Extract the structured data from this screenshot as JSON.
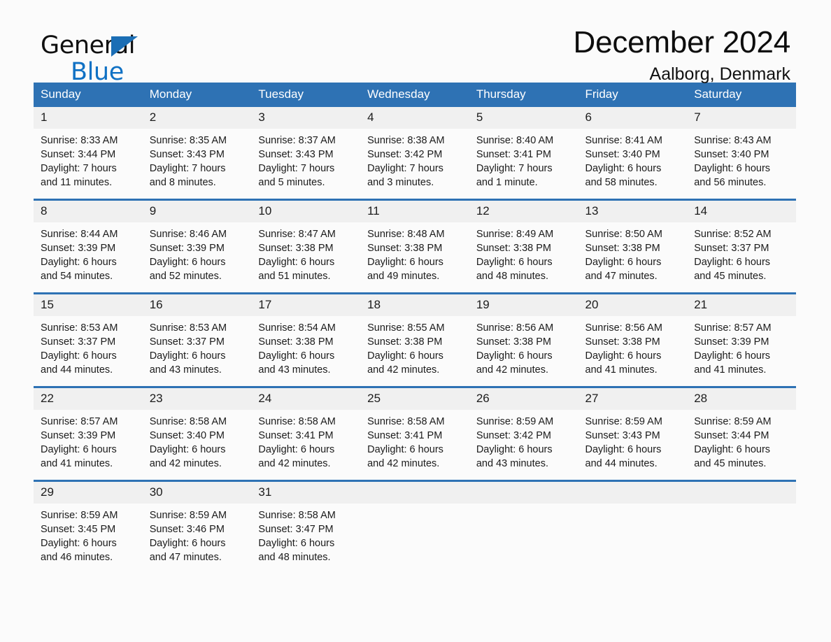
{
  "brand": {
    "name_part1": "General",
    "name_part2": "Blue",
    "triangle_color": "#1b6eb5",
    "text_color_part2": "#1071c4"
  },
  "header": {
    "month_title": "December 2024",
    "location": "Aalborg, Denmark"
  },
  "theme": {
    "header_blue": "#2e72b4",
    "daynum_band": "#f0f0f0",
    "page_background": "#fbfbfb"
  },
  "calendar": {
    "weekday_headers": [
      "Sunday",
      "Monday",
      "Tuesday",
      "Wednesday",
      "Thursday",
      "Friday",
      "Saturday"
    ],
    "labels": {
      "sunrise": "Sunrise:",
      "sunset": "Sunset:",
      "daylight": "Daylight:"
    },
    "weeks": [
      [
        {
          "day": "1",
          "sunrise": "Sunrise: 8:33 AM",
          "sunset": "Sunset: 3:44 PM",
          "daylight_line1": "Daylight: 7 hours",
          "daylight_line2": "and 11 minutes."
        },
        {
          "day": "2",
          "sunrise": "Sunrise: 8:35 AM",
          "sunset": "Sunset: 3:43 PM",
          "daylight_line1": "Daylight: 7 hours",
          "daylight_line2": "and 8 minutes."
        },
        {
          "day": "3",
          "sunrise": "Sunrise: 8:37 AM",
          "sunset": "Sunset: 3:43 PM",
          "daylight_line1": "Daylight: 7 hours",
          "daylight_line2": "and 5 minutes."
        },
        {
          "day": "4",
          "sunrise": "Sunrise: 8:38 AM",
          "sunset": "Sunset: 3:42 PM",
          "daylight_line1": "Daylight: 7 hours",
          "daylight_line2": "and 3 minutes."
        },
        {
          "day": "5",
          "sunrise": "Sunrise: 8:40 AM",
          "sunset": "Sunset: 3:41 PM",
          "daylight_line1": "Daylight: 7 hours",
          "daylight_line2": "and 1 minute."
        },
        {
          "day": "6",
          "sunrise": "Sunrise: 8:41 AM",
          "sunset": "Sunset: 3:40 PM",
          "daylight_line1": "Daylight: 6 hours",
          "daylight_line2": "and 58 minutes."
        },
        {
          "day": "7",
          "sunrise": "Sunrise: 8:43 AM",
          "sunset": "Sunset: 3:40 PM",
          "daylight_line1": "Daylight: 6 hours",
          "daylight_line2": "and 56 minutes."
        }
      ],
      [
        {
          "day": "8",
          "sunrise": "Sunrise: 8:44 AM",
          "sunset": "Sunset: 3:39 PM",
          "daylight_line1": "Daylight: 6 hours",
          "daylight_line2": "and 54 minutes."
        },
        {
          "day": "9",
          "sunrise": "Sunrise: 8:46 AM",
          "sunset": "Sunset: 3:39 PM",
          "daylight_line1": "Daylight: 6 hours",
          "daylight_line2": "and 52 minutes."
        },
        {
          "day": "10",
          "sunrise": "Sunrise: 8:47 AM",
          "sunset": "Sunset: 3:38 PM",
          "daylight_line1": "Daylight: 6 hours",
          "daylight_line2": "and 51 minutes."
        },
        {
          "day": "11",
          "sunrise": "Sunrise: 8:48 AM",
          "sunset": "Sunset: 3:38 PM",
          "daylight_line1": "Daylight: 6 hours",
          "daylight_line2": "and 49 minutes."
        },
        {
          "day": "12",
          "sunrise": "Sunrise: 8:49 AM",
          "sunset": "Sunset: 3:38 PM",
          "daylight_line1": "Daylight: 6 hours",
          "daylight_line2": "and 48 minutes."
        },
        {
          "day": "13",
          "sunrise": "Sunrise: 8:50 AM",
          "sunset": "Sunset: 3:38 PM",
          "daylight_line1": "Daylight: 6 hours",
          "daylight_line2": "and 47 minutes."
        },
        {
          "day": "14",
          "sunrise": "Sunrise: 8:52 AM",
          "sunset": "Sunset: 3:37 PM",
          "daylight_line1": "Daylight: 6 hours",
          "daylight_line2": "and 45 minutes."
        }
      ],
      [
        {
          "day": "15",
          "sunrise": "Sunrise: 8:53 AM",
          "sunset": "Sunset: 3:37 PM",
          "daylight_line1": "Daylight: 6 hours",
          "daylight_line2": "and 44 minutes."
        },
        {
          "day": "16",
          "sunrise": "Sunrise: 8:53 AM",
          "sunset": "Sunset: 3:37 PM",
          "daylight_line1": "Daylight: 6 hours",
          "daylight_line2": "and 43 minutes."
        },
        {
          "day": "17",
          "sunrise": "Sunrise: 8:54 AM",
          "sunset": "Sunset: 3:38 PM",
          "daylight_line1": "Daylight: 6 hours",
          "daylight_line2": "and 43 minutes."
        },
        {
          "day": "18",
          "sunrise": "Sunrise: 8:55 AM",
          "sunset": "Sunset: 3:38 PM",
          "daylight_line1": "Daylight: 6 hours",
          "daylight_line2": "and 42 minutes."
        },
        {
          "day": "19",
          "sunrise": "Sunrise: 8:56 AM",
          "sunset": "Sunset: 3:38 PM",
          "daylight_line1": "Daylight: 6 hours",
          "daylight_line2": "and 42 minutes."
        },
        {
          "day": "20",
          "sunrise": "Sunrise: 8:56 AM",
          "sunset": "Sunset: 3:38 PM",
          "daylight_line1": "Daylight: 6 hours",
          "daylight_line2": "and 41 minutes."
        },
        {
          "day": "21",
          "sunrise": "Sunrise: 8:57 AM",
          "sunset": "Sunset: 3:39 PM",
          "daylight_line1": "Daylight: 6 hours",
          "daylight_line2": "and 41 minutes."
        }
      ],
      [
        {
          "day": "22",
          "sunrise": "Sunrise: 8:57 AM",
          "sunset": "Sunset: 3:39 PM",
          "daylight_line1": "Daylight: 6 hours",
          "daylight_line2": "and 41 minutes."
        },
        {
          "day": "23",
          "sunrise": "Sunrise: 8:58 AM",
          "sunset": "Sunset: 3:40 PM",
          "daylight_line1": "Daylight: 6 hours",
          "daylight_line2": "and 42 minutes."
        },
        {
          "day": "24",
          "sunrise": "Sunrise: 8:58 AM",
          "sunset": "Sunset: 3:41 PM",
          "daylight_line1": "Daylight: 6 hours",
          "daylight_line2": "and 42 minutes."
        },
        {
          "day": "25",
          "sunrise": "Sunrise: 8:58 AM",
          "sunset": "Sunset: 3:41 PM",
          "daylight_line1": "Daylight: 6 hours",
          "daylight_line2": "and 42 minutes."
        },
        {
          "day": "26",
          "sunrise": "Sunrise: 8:59 AM",
          "sunset": "Sunset: 3:42 PM",
          "daylight_line1": "Daylight: 6 hours",
          "daylight_line2": "and 43 minutes."
        },
        {
          "day": "27",
          "sunrise": "Sunrise: 8:59 AM",
          "sunset": "Sunset: 3:43 PM",
          "daylight_line1": "Daylight: 6 hours",
          "daylight_line2": "and 44 minutes."
        },
        {
          "day": "28",
          "sunrise": "Sunrise: 8:59 AM",
          "sunset": "Sunset: 3:44 PM",
          "daylight_line1": "Daylight: 6 hours",
          "daylight_line2": "and 45 minutes."
        }
      ],
      [
        {
          "day": "29",
          "sunrise": "Sunrise: 8:59 AM",
          "sunset": "Sunset: 3:45 PM",
          "daylight_line1": "Daylight: 6 hours",
          "daylight_line2": "and 46 minutes."
        },
        {
          "day": "30",
          "sunrise": "Sunrise: 8:59 AM",
          "sunset": "Sunset: 3:46 PM",
          "daylight_line1": "Daylight: 6 hours",
          "daylight_line2": "and 47 minutes."
        },
        {
          "day": "31",
          "sunrise": "Sunrise: 8:58 AM",
          "sunset": "Sunset: 3:47 PM",
          "daylight_line1": "Daylight: 6 hours",
          "daylight_line2": "and 48 minutes."
        },
        {
          "day": "",
          "sunrise": "",
          "sunset": "",
          "daylight_line1": "",
          "daylight_line2": ""
        },
        {
          "day": "",
          "sunrise": "",
          "sunset": "",
          "daylight_line1": "",
          "daylight_line2": ""
        },
        {
          "day": "",
          "sunrise": "",
          "sunset": "",
          "daylight_line1": "",
          "daylight_line2": ""
        },
        {
          "day": "",
          "sunrise": "",
          "sunset": "",
          "daylight_line1": "",
          "daylight_line2": ""
        }
      ]
    ]
  }
}
